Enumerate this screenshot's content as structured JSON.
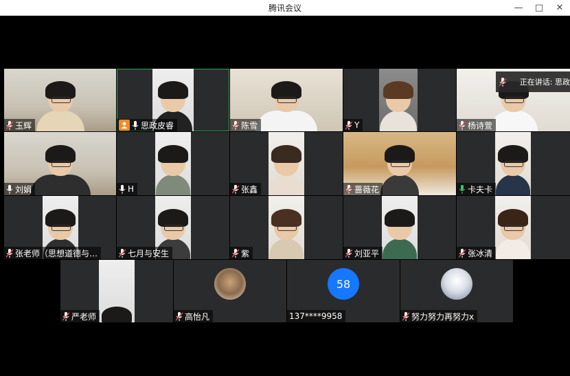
{
  "window": {
    "title": "腾讯会议"
  },
  "speaking": {
    "text": "正在讲话: 思政"
  },
  "participants": [
    {
      "name": "玉辉",
      "mic": "muted"
    },
    {
      "name": "思政皮睿",
      "mic": "on",
      "host": true
    },
    {
      "name": "陈雪",
      "mic": "muted"
    },
    {
      "name": "Y",
      "mic": "muted"
    },
    {
      "name": "杨诗萱",
      "mic": "muted"
    },
    {
      "name": "刘娟",
      "mic": "on"
    },
    {
      "name": "H",
      "mic": "on"
    },
    {
      "name": "张鑫",
      "mic": "muted"
    },
    {
      "name": "蔷薇花",
      "mic": "muted"
    },
    {
      "name": "卡夫卡",
      "mic": "speaking"
    },
    {
      "name": "张老师（思想道德与…",
      "mic": "muted"
    },
    {
      "name": "七月与安生",
      "mic": "muted"
    },
    {
      "name": "紫",
      "mic": "muted"
    },
    {
      "name": "刘亚平",
      "mic": "muted"
    },
    {
      "name": "张冰清",
      "mic": "muted"
    },
    {
      "name": "严老师",
      "mic": "muted"
    },
    {
      "name": "高怡凡",
      "mic": "muted"
    },
    {
      "name": "137****9958",
      "mic": "none",
      "avatar_text": "58"
    },
    {
      "name": "努力努力再努力x",
      "mic": "muted"
    }
  ],
  "colors": {
    "accent": "#1677ff",
    "active_border": "#2fa84f",
    "muted_icon": "#e5484d",
    "host_badge": "#f08a24"
  }
}
